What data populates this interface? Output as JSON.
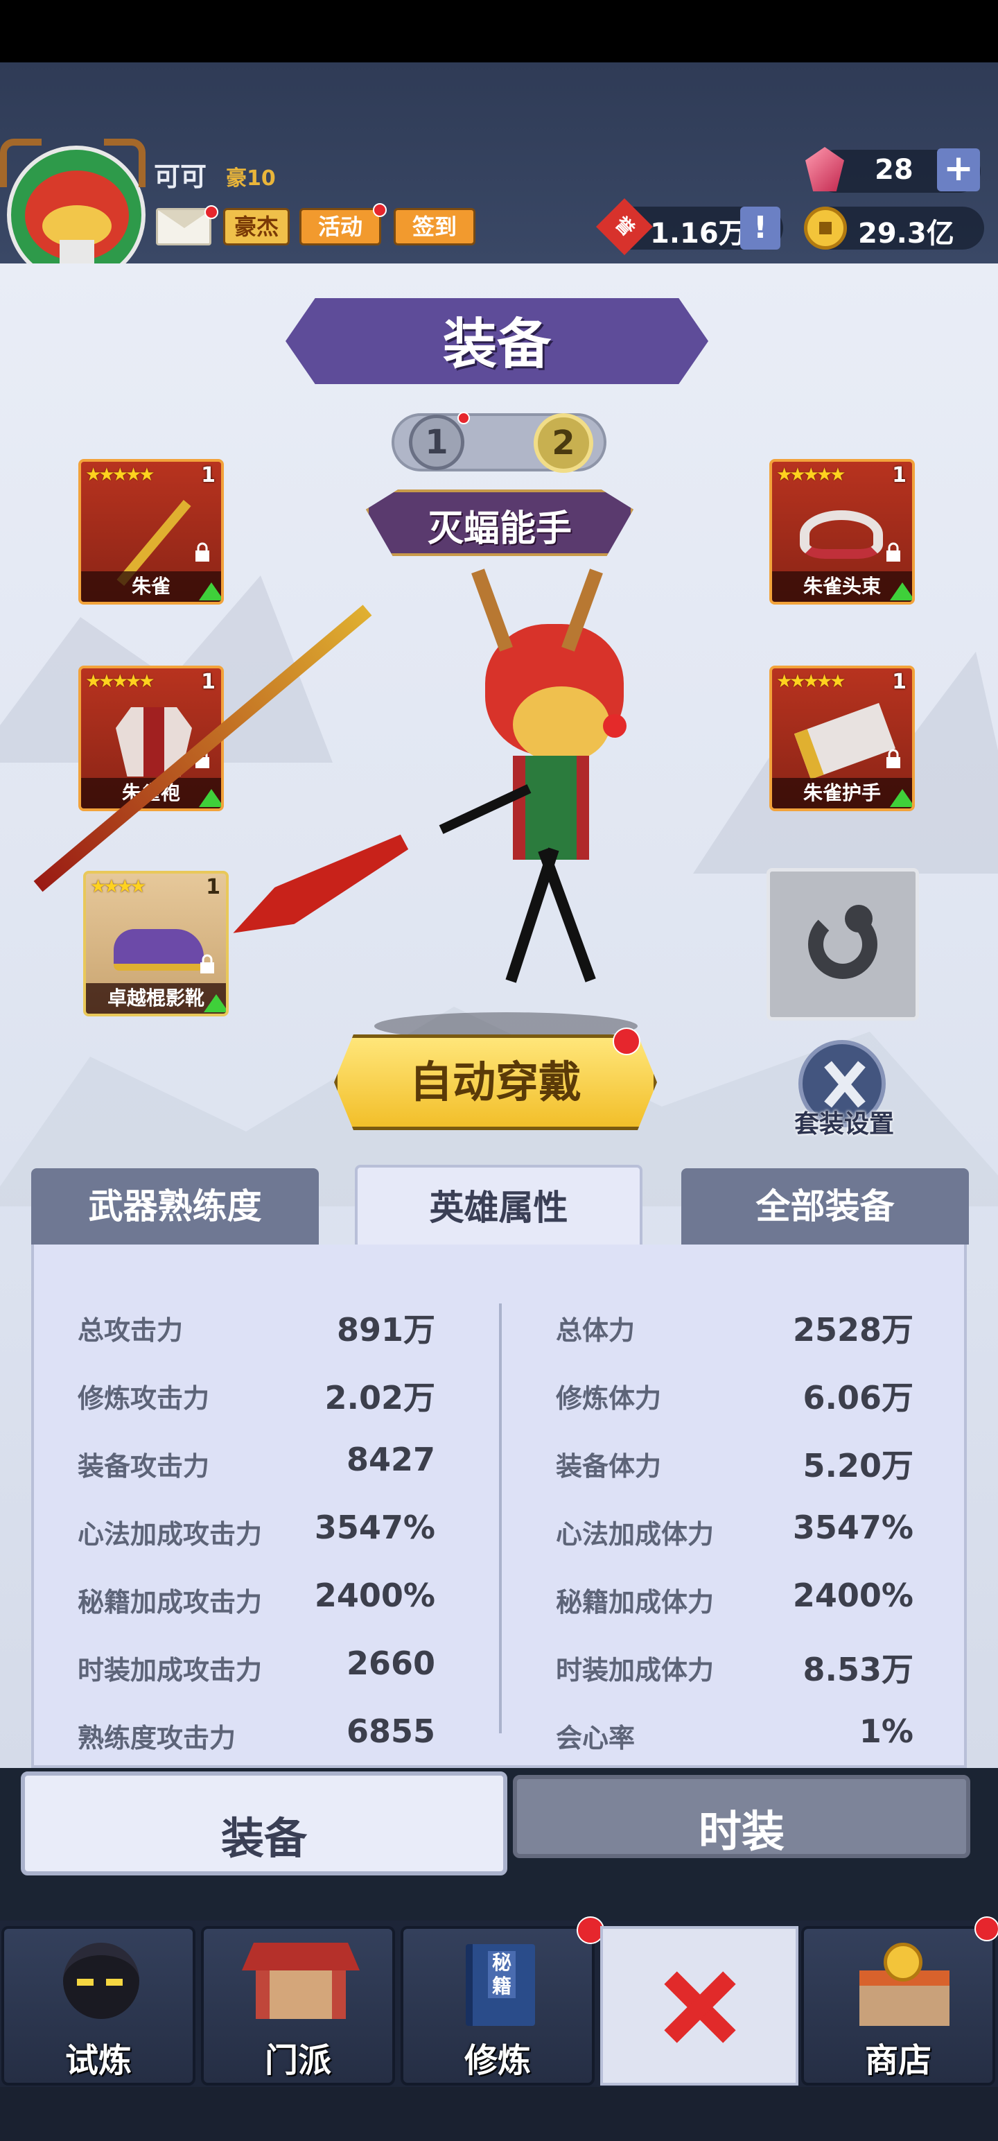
{
  "player": {
    "name": "可可",
    "vip": "豪10"
  },
  "header_buttons": {
    "hero": "豪杰",
    "activity": "活动",
    "checkin": "签到"
  },
  "currency": {
    "gems": "28",
    "plus": "+",
    "honor": "1.16万",
    "honor_icon": "誉",
    "info": "!",
    "gold": "29.3亿"
  },
  "page_title": "装备",
  "loadout_tabs": [
    "1",
    "2"
  ],
  "hero_title": "灭蝠能手",
  "slots": {
    "weapon": {
      "name": "朱雀",
      "level": "1",
      "stars": "★★★★★"
    },
    "head": {
      "name": "朱雀头束",
      "level": "1",
      "stars": "★★★★★"
    },
    "body": {
      "name": "朱雀袍",
      "level": "1",
      "stars": "★★★★★"
    },
    "hand": {
      "name": "朱雀护手",
      "level": "1",
      "stars": "★★★★★"
    },
    "boots": {
      "name": "卓越棍影靴",
      "level": "1",
      "stars": "★★★★"
    }
  },
  "auto_equip": "自动穿戴",
  "set_settings": "套装设置",
  "stat_tabs": {
    "mastery": "武器熟练度",
    "attributes": "英雄属性",
    "all_gear": "全部装备"
  },
  "stats_left": [
    {
      "label": "总攻击力",
      "value": "891万"
    },
    {
      "label": "修炼攻击力",
      "value": "2.02万"
    },
    {
      "label": "装备攻击力",
      "value": "8427"
    },
    {
      "label": "心法加成攻击力",
      "value": "3547%"
    },
    {
      "label": "秘籍加成攻击力",
      "value": "2400%"
    },
    {
      "label": "时装加成攻击力",
      "value": "2660"
    },
    {
      "label": "熟练度攻击力",
      "value": "6855"
    }
  ],
  "stats_right": [
    {
      "label": "总体力",
      "value": "2528万"
    },
    {
      "label": "修炼体力",
      "value": "6.06万"
    },
    {
      "label": "装备体力",
      "value": "5.20万"
    },
    {
      "label": "心法加成体力",
      "value": "3547%"
    },
    {
      "label": "秘籍加成体力",
      "value": "2400%"
    },
    {
      "label": "时装加成体力",
      "value": "8.53万"
    },
    {
      "label": "会心率",
      "value": "1%"
    }
  ],
  "bottom_tabs": {
    "equipment": "装备",
    "fashion": "时装"
  },
  "nav": [
    {
      "label": "试炼"
    },
    {
      "label": "门派"
    },
    {
      "label": "修炼",
      "book_text": "秘籍"
    },
    {
      "label": ""
    },
    {
      "label": "商店"
    }
  ],
  "colors": {
    "accent": "#f2c230",
    "title_banner": "#5e4c99",
    "slot_border": "#f2a33b",
    "badge": "#e6262d"
  }
}
